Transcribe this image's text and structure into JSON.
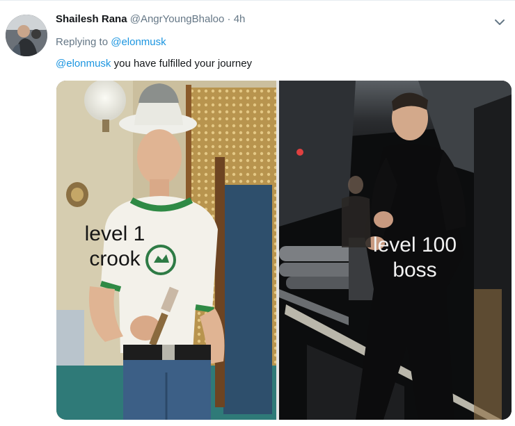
{
  "tweet": {
    "author_name": "Shailesh Rana",
    "author_handle": "@AngrYoungBhaloo",
    "separator": "·",
    "timestamp": "4h",
    "replying_prefix": "Replying to",
    "replying_to": "@elonmusk",
    "text_mention": "@elonmusk",
    "text_body": "you have fulfilled your journey",
    "menu_icon": "chevron-down-icon"
  },
  "media": {
    "left_caption_line1": "level 1",
    "left_caption_line2": "crook",
    "right_caption_line1": "level 100",
    "right_caption_line2": "boss",
    "colors": {
      "link": "#1b95e0",
      "muted": "#657786"
    }
  }
}
